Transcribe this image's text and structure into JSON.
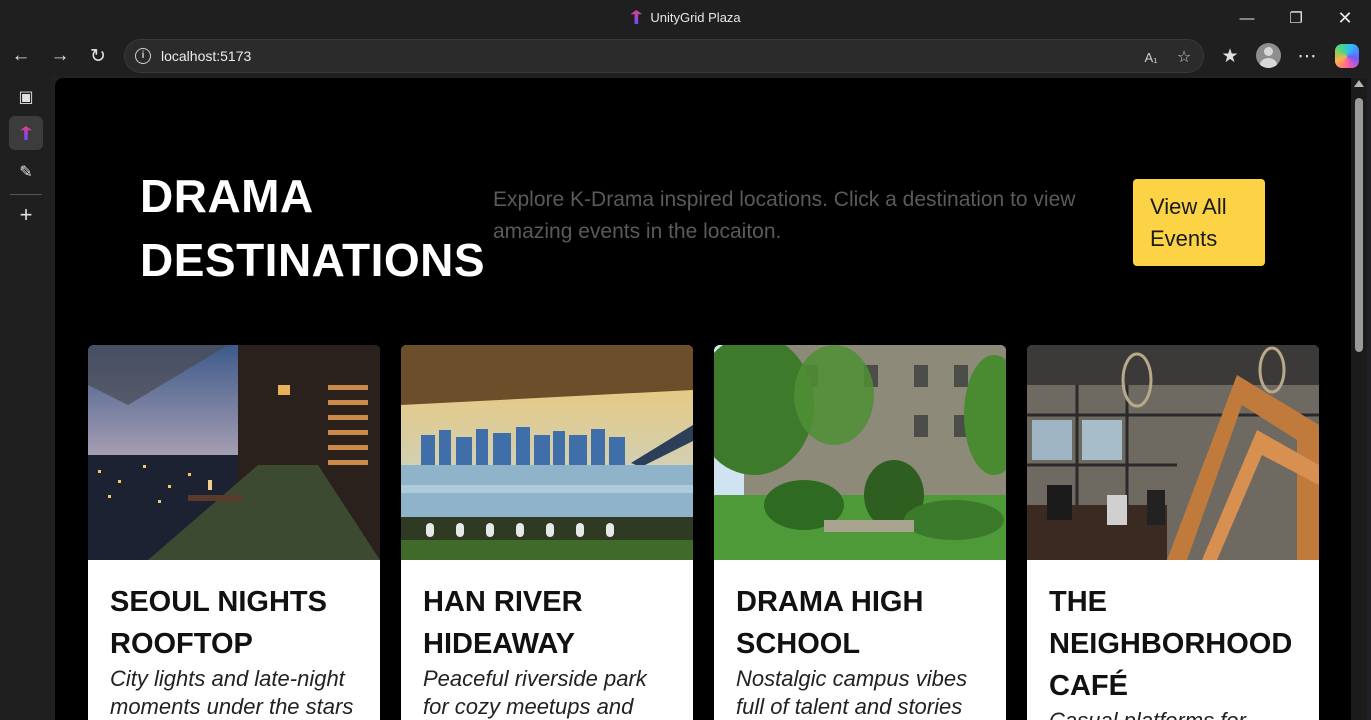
{
  "window": {
    "title": "UnityGrid Plaza"
  },
  "browser": {
    "url": "localhost:5173"
  },
  "hero": {
    "title_line1": "DRAMA",
    "title_line2": "DESTINATIONS",
    "description": "Explore K-Drama inspired locations. Click a destination to view amazing events in the locaiton.",
    "button_line1": "View All",
    "button_line2": "Events"
  },
  "cards": [
    {
      "title_line1": "SEOUL NIGHTS",
      "title_line2": "ROOFTOP",
      "title_line3": "",
      "desc_line1": "City lights and late-night",
      "desc_line2": "moments under the stars"
    },
    {
      "title_line1": "HAN RIVER",
      "title_line2": "HIDEAWAY",
      "title_line3": "",
      "desc_line1": "Peaceful riverside park",
      "desc_line2": "for cozy meetups and"
    },
    {
      "title_line1": "DRAMA HIGH",
      "title_line2": "SCHOOL",
      "title_line3": "",
      "desc_line1": "Nostalgic campus vibes",
      "desc_line2": "full of talent and stories"
    },
    {
      "title_line1": "THE",
      "title_line2": "NEIGHBORHOOD",
      "title_line3": "CAFÉ",
      "desc_line1": "Casual platforms for",
      "desc_line2": ""
    }
  ],
  "colors": {
    "accent": "#fdd346",
    "page_bg": "#000000",
    "card_bg": "#ffffff"
  }
}
